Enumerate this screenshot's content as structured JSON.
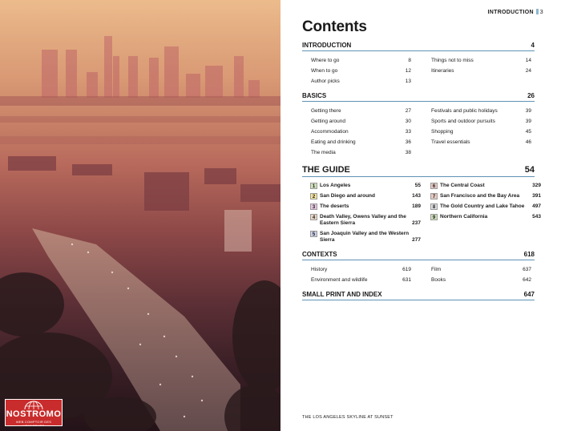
{
  "logo": {
    "name": "NOSTROMO",
    "tagline": "WEB COMPTOIR DES VOYAGEURS",
    "color": "#c92c2c"
  },
  "running_head": {
    "label": "INTRODUCTION",
    "page": "3"
  },
  "title": "Contents",
  "accent_color": "#5f93b5",
  "introduction": {
    "heading": "INTRODUCTION",
    "page": "4",
    "left": [
      {
        "title": "Where to go",
        "page": "8"
      },
      {
        "title": "When to go",
        "page": "12"
      },
      {
        "title": "Author picks",
        "page": "13"
      }
    ],
    "right": [
      {
        "title": "Things not to miss",
        "page": "14"
      },
      {
        "title": "Itineraries",
        "page": "24"
      }
    ]
  },
  "basics": {
    "heading": "BASICS",
    "page": "26",
    "left": [
      {
        "title": "Getting there",
        "page": "27"
      },
      {
        "title": "Getting around",
        "page": "30"
      },
      {
        "title": "Accommodation",
        "page": "33"
      },
      {
        "title": "Eating and drinking",
        "page": "36"
      },
      {
        "title": "The media",
        "page": "38"
      }
    ],
    "right": [
      {
        "title": "Festivals and public holidays",
        "page": "39"
      },
      {
        "title": "Sports and outdoor pursuits",
        "page": "39"
      },
      {
        "title": "Shopping",
        "page": "45"
      },
      {
        "title": "Travel essentials",
        "page": "46"
      }
    ]
  },
  "guide": {
    "heading": "THE GUIDE",
    "page": "54",
    "left": [
      {
        "num": "1",
        "title": "Los Angeles",
        "page": "55",
        "color": "#cfe0b8"
      },
      {
        "num": "2",
        "title": "San Diego and around",
        "page": "143",
        "color": "#f3e39a"
      },
      {
        "num": "3",
        "title": "The deserts",
        "page": "189",
        "color": "#e6c6e0"
      },
      {
        "num": "4",
        "title": "Death Valley, Owens Valley and the Eastern Sierra",
        "page": "237",
        "color": "#e9d7c6"
      },
      {
        "num": "5",
        "title": "San Joaquin Valley and the Western Sierra",
        "page": "277",
        "color": "#c9cfe8"
      }
    ],
    "right": [
      {
        "num": "6",
        "title": "The Central Coast",
        "page": "329",
        "color": "#e8c9c2"
      },
      {
        "num": "7",
        "title": "San Francisco and the Bay Area",
        "page": "391",
        "color": "#e8c9c2"
      },
      {
        "num": "8",
        "title": "The Gold Country and Lake Tahoe",
        "page": "497",
        "color": "#dfe0e3"
      },
      {
        "num": "9",
        "title": "Northern California",
        "page": "543",
        "color": "#cfe0b8"
      }
    ]
  },
  "contexts": {
    "heading": "CONTEXTS",
    "page": "618",
    "left": [
      {
        "title": "History",
        "page": "619"
      },
      {
        "title": "Environment and wildlife",
        "page": "631"
      }
    ],
    "right": [
      {
        "title": "Film",
        "page": "637"
      },
      {
        "title": "Books",
        "page": "642"
      }
    ]
  },
  "small_print": {
    "heading": "SMALL PRINT AND INDEX",
    "page": "647"
  },
  "caption": "THE LOS ANGELES SKYLINE AT SUNSET"
}
